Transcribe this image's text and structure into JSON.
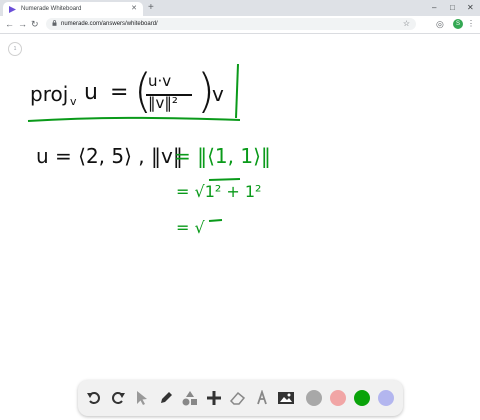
{
  "browser": {
    "tab_title": "Numerade Whiteboard",
    "tab_close": "✕",
    "new_tab": "+",
    "url": "numerade.com/answers/whiteboard/",
    "profile_initial": "S",
    "window_minimize": "–",
    "window_maximize": "□",
    "window_close": "✕"
  },
  "whiteboard": {
    "page_number": "1",
    "formula": {
      "proj": "proj",
      "sub_v": "v",
      "u": "u",
      "eq": "=",
      "numerator": "u·v",
      "denominator": "‖v‖²",
      "open_paren": "(",
      "close_paren": ")",
      "v": "v"
    },
    "line2_black": "u = ⟨2, 5⟩ , ‖v‖",
    "line2_green": "= ‖⟨1, 1⟩‖",
    "line3": "= √1² + 1²",
    "line4": "= √"
  },
  "palette": {
    "colors": {
      "gray": "#a8a8a8",
      "pink": "#f1a5a5",
      "green": "#0aa30a",
      "lavender": "#b3b6ef"
    },
    "tools": [
      "undo-icon",
      "redo-icon",
      "select-icon",
      "pen-icon",
      "shapes-icon",
      "add-icon",
      "eraser-icon",
      "text-icon",
      "image-icon"
    ]
  }
}
